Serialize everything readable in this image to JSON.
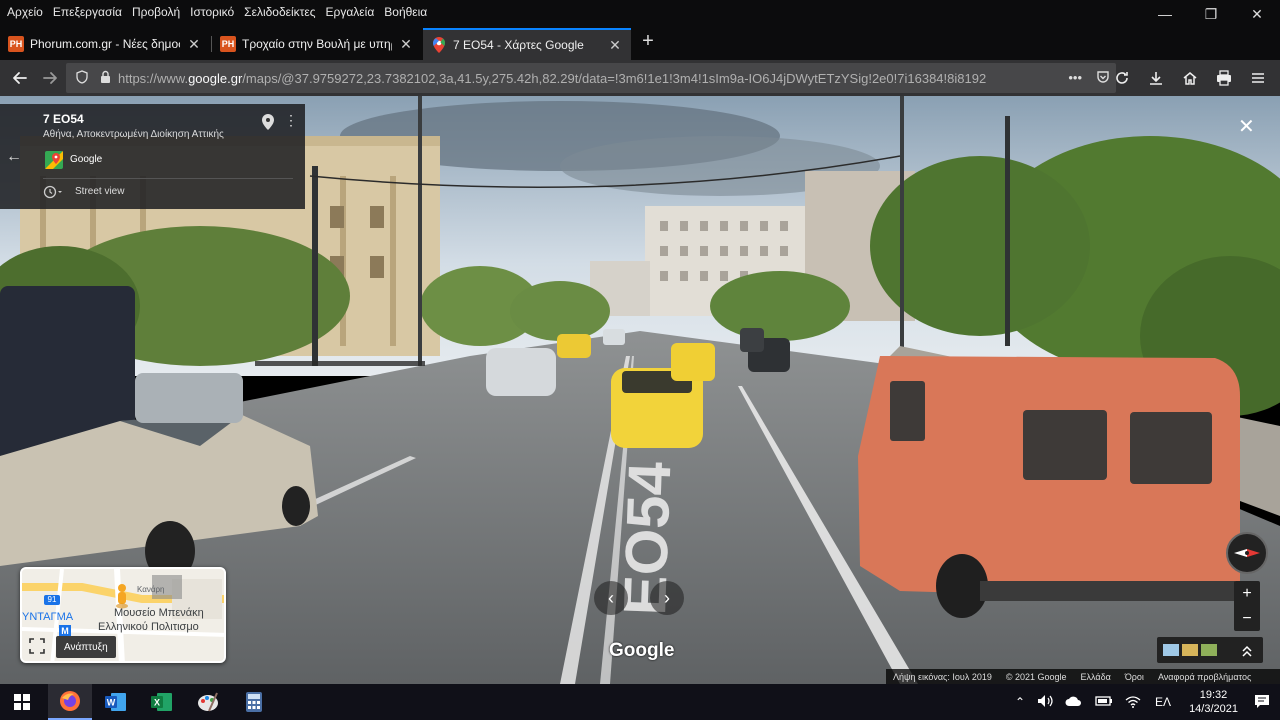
{
  "menubar": {
    "items": [
      "Αρχείο",
      "Επεξεργασία",
      "Προβολή",
      "Ιστορικό",
      "Σελιδοδείκτες",
      "Εργαλεία",
      "Βοήθεια"
    ]
  },
  "tabs": [
    {
      "title": "Phorum.com.gr - Νέες δημοσι",
      "favicon": "PH"
    },
    {
      "title": "Τροχαίο στην Βουλή με υπηρε",
      "favicon": "PH"
    },
    {
      "title": "7 ΕΟ54 - Χάρτες Google",
      "favicon": "maps-pin"
    }
  ],
  "address": {
    "url_prefix": "https://www.",
    "url_domain": "google.gr",
    "url_rest": "/maps/@37.9759272,23.7382102,3a,41.5y,275.42h,82.29t/data=!3m6!1e1!3m4!1sIm9a-IO6J4jDWytETzYSig!2e0!7i16384!8i8192"
  },
  "infocard": {
    "title": "7 ΕΟ54",
    "subtitle": "Αθήνα, Αποκεντρωμένη Διοίκηση Αττικής",
    "provider": "Google",
    "mode": "Street view"
  },
  "minimap": {
    "label_syntagma": "ΥΝΤΑΓΜΑ",
    "label_museum_1": "Μουσείο Μπενάκη",
    "label_museum_2": "Ελληνικού Πολιτισμο",
    "label_street": "Κανάρη",
    "road_number": "91",
    "metro": "M",
    "expand_label": "Ανάπτυξη"
  },
  "watermark": "Google",
  "road_marking": "ΕΟ54",
  "footer": {
    "capture": "Λήψη εικόνας: Ιουλ 2019",
    "copyright": "© 2021 Google",
    "country": "Ελλάδα",
    "terms": "Όροι",
    "report": "Αναφορά προβλήματος"
  },
  "taskbar": {
    "language": "ΕΛ",
    "time": "19:32",
    "date": "14/3/2021"
  },
  "colors": {
    "chrome_dark": "#0c0c0d",
    "toolbar": "#323234",
    "accent": "#0a84ff",
    "taxi_yellow": "#f2d33a",
    "van_orange": "#d97758"
  }
}
